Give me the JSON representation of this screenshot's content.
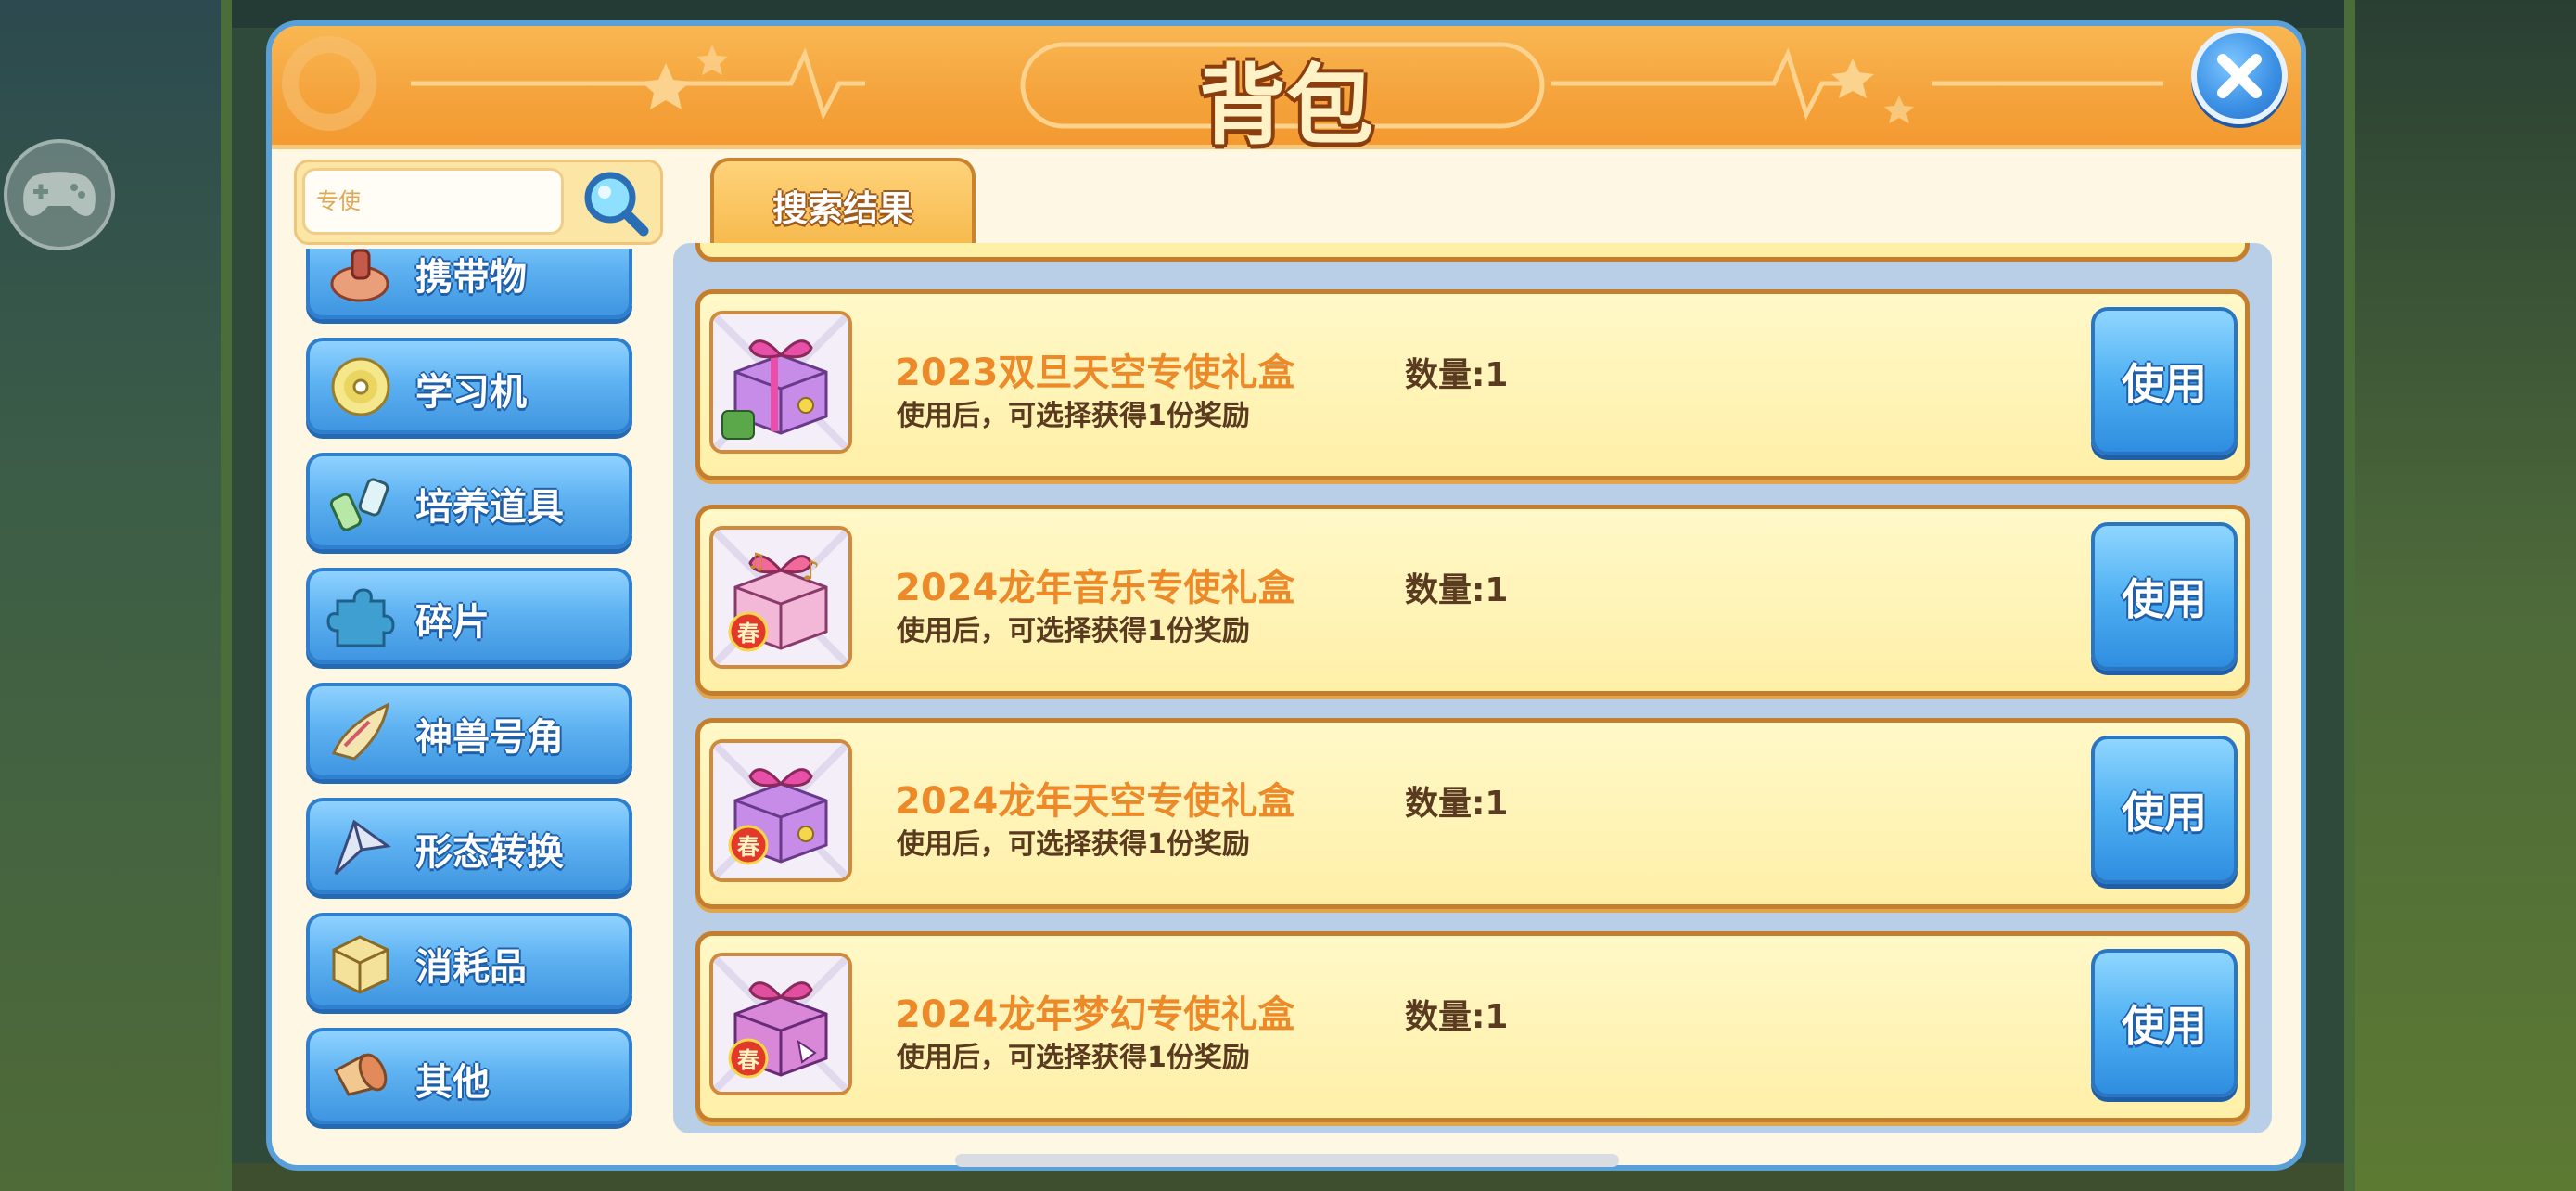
{
  "window": {
    "title": "背包",
    "close_label": "✕"
  },
  "search": {
    "value": "",
    "placeholder": "专使"
  },
  "sidebar": {
    "items": [
      {
        "label": "携带物",
        "icon": "carry-item-icon"
      },
      {
        "label": "学习机",
        "icon": "disc-icon"
      },
      {
        "label": "培养道具",
        "icon": "potion-icon"
      },
      {
        "label": "碎片",
        "icon": "puzzle-piece-icon"
      },
      {
        "label": "神兽号角",
        "icon": "horn-icon"
      },
      {
        "label": "形态转换",
        "icon": "arrow-icon"
      },
      {
        "label": "消耗品",
        "icon": "box-icon"
      },
      {
        "label": "其他",
        "icon": "megaphone-icon"
      }
    ]
  },
  "tabs": [
    {
      "label": "搜索结果",
      "active": true
    }
  ],
  "items": [
    {
      "name": "2023双旦天空专使礼盒",
      "desc": "使用后，可选择获得1份奖励",
      "qty": "数量:1",
      "button": "使用",
      "ribbon_color": "#e84fa8",
      "badge": "gift-box-icon"
    },
    {
      "name": "2024龙年音乐专使礼盒",
      "desc": "使用后，可选择获得1份奖励",
      "qty": "数量:1",
      "button": "使用",
      "ribbon_color": "#f06a9a",
      "badge": "music-gift-icon"
    },
    {
      "name": "2024龙年天空专使礼盒",
      "desc": "使用后，可选择获得1份奖励",
      "qty": "数量:1",
      "button": "使用",
      "ribbon_color": "#e84fa8",
      "badge": "sky-gift-icon"
    },
    {
      "name": "2024龙年梦幻专使礼盒",
      "desc": "使用后，可选择获得1份奖励",
      "qty": "数量:1",
      "button": "使用",
      "ribbon_color": "#e24fa0",
      "badge": "dream-gift-icon"
    }
  ],
  "badges": {
    "spring": "春"
  },
  "colors": {
    "accent_orange": "#f5a33c",
    "button_blue": "#4fb0f2",
    "item_name": "#ec8a2a"
  }
}
